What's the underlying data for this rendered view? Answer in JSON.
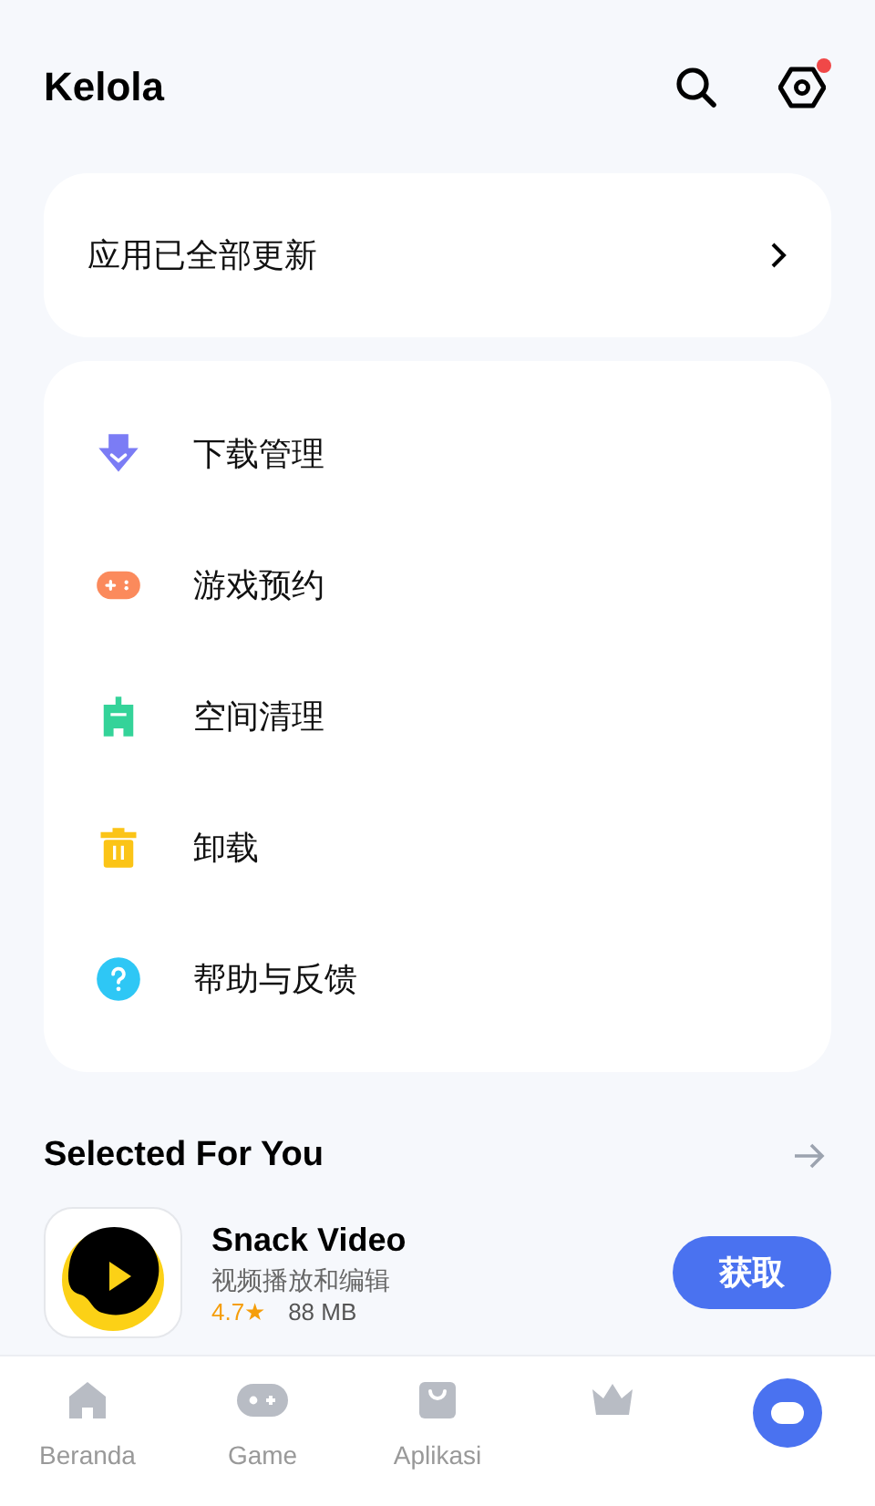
{
  "header": {
    "title": "Kelola",
    "settings_badge": true
  },
  "update_card": {
    "label": "应用已全部更新"
  },
  "menu": [
    {
      "label": "下载管理",
      "color": "#7b7cf5"
    },
    {
      "label": "游戏预约",
      "color": "#fb8a5c"
    },
    {
      "label": "空间清理",
      "color": "#34d399"
    },
    {
      "label": "卸载",
      "color": "#fbc417"
    },
    {
      "label": "帮助与反馈",
      "color": "#2ec7f5"
    }
  ],
  "section": {
    "title": "Selected For You"
  },
  "apps": [
    {
      "name": "Snack Video",
      "subtitle": "视频播放和编辑",
      "rating": "4.7★",
      "size": "88 MB",
      "button": "获取"
    }
  ],
  "nav": [
    {
      "label": "Beranda",
      "selected": false
    },
    {
      "label": "Game",
      "selected": false
    },
    {
      "label": "Aplikasi",
      "selected": false
    },
    {
      "selected": false
    },
    {
      "selected": true
    }
  ]
}
